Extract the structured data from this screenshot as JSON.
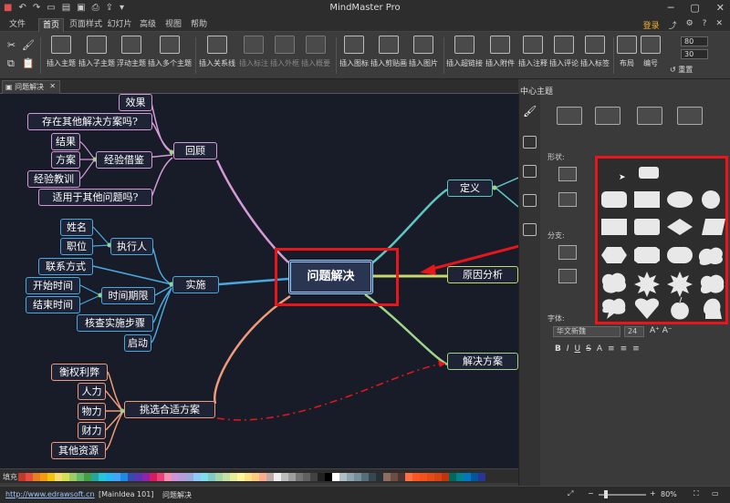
{
  "app": {
    "title": "MindMaster Pro",
    "menus": [
      "文件",
      "首页",
      "页面样式",
      "幻灯片",
      "高级",
      "视图",
      "帮助"
    ],
    "active_menu": "首页",
    "login": "登录"
  },
  "ribbon": {
    "buttons": [
      {
        "label": "插入主题"
      },
      {
        "label": "插入子主题"
      },
      {
        "label": "浮动主题"
      },
      {
        "label": "插入多个主题"
      },
      {
        "label": "插入关系线"
      },
      {
        "label": "插入标注"
      },
      {
        "label": "插入外框"
      },
      {
        "label": "插入概要"
      },
      {
        "label": "插入图标"
      },
      {
        "label": "插入剪贴画"
      },
      {
        "label": "插入图片"
      },
      {
        "label": "插入超链接"
      },
      {
        "label": "插入附件"
      },
      {
        "label": "插入注释"
      },
      {
        "label": "插入评论"
      },
      {
        "label": "插入标签"
      },
      {
        "label": "布局"
      },
      {
        "label": "编号"
      }
    ],
    "spin1": "80",
    "spin2": "30",
    "reset": "重置"
  },
  "document_tab": "问题解决",
  "mindmap": {
    "central": "问题解决",
    "nodes": {
      "xiaoguo": "效果",
      "qita_fangan": "存在其他解决方案吗?",
      "jieguo": "结果",
      "fangan": "方案",
      "jingyan_jiejian": "经验借鉴",
      "jingyan_jiaoxun": "经验教训",
      "huigu": "回顾",
      "shiyong": "适用于其他问题吗?",
      "xingming": "姓名",
      "zhiwei": "职位",
      "zhixingren": "执行人",
      "lianxi": "联系方式",
      "shishi": "实施",
      "kaishi": "开始时间",
      "shijianqixian": "时间期限",
      "jieshu": "结束时间",
      "heshi": "核查实施步骤",
      "qidong": "启动",
      "hengquan": "衡权利弊",
      "renli": "人力",
      "wuli": "物力",
      "caili": "财力",
      "qita_ziyuan": "其他资源",
      "tiaoxuan": "挑选合适方案",
      "dingyi": "定义",
      "yuanyin": "原因分析",
      "jiejue": "解决方案"
    }
  },
  "panel": {
    "title": "中心主题",
    "shape_label": "形状:",
    "branch_label": "分支:",
    "font_label": "字体:",
    "font_name": "华文新魏",
    "font_size": "24"
  },
  "status": {
    "fill_label": "填充",
    "url": "http://www.edrawsoft.cn",
    "file": "[MainIdea 101]",
    "doc": "问题解决",
    "zoom": "80%"
  },
  "colors": {
    "accent_red": "#e8161b",
    "canvas_bg": "#181c28"
  }
}
